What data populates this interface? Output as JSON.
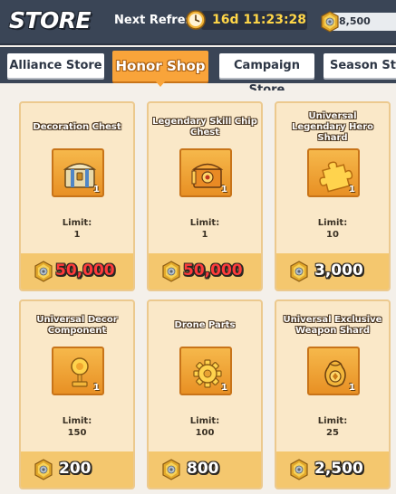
{
  "header": {
    "title": "STORE",
    "refresh_label": "Next Refresh:",
    "timer": "16d 11:23:28",
    "honor_balance": "8,500"
  },
  "tabs": [
    {
      "label": "Alliance Store",
      "active": false
    },
    {
      "label": "Honor Shop",
      "active": true
    },
    {
      "label": "Campaign Store",
      "active": false
    },
    {
      "label": "Season St",
      "active": false
    }
  ],
  "items": [
    {
      "name": "Decoration Chest",
      "qty": "1",
      "limit_label": "Limit:",
      "limit": "1",
      "price": "50,000",
      "price_color": "#ff3b3b",
      "icon": "chest-icon"
    },
    {
      "name": "Legendary Skill Chip Chest",
      "qty": "1",
      "limit_label": "Limit:",
      "limit": "1",
      "price": "50,000",
      "price_color": "#ff3b3b",
      "icon": "skill-chip-chest-icon"
    },
    {
      "name": "Universal Legendary Hero Shard",
      "qty": "1",
      "limit_label": "Limit:",
      "limit": "10",
      "price": "3,000",
      "price_color": "#ffffff",
      "icon": "puzzle-piece-icon"
    },
    {
      "name": "Universal Decor Component",
      "qty": "1",
      "limit_label": "Limit:",
      "limit": "150",
      "price": "200",
      "price_color": "#ffffff",
      "icon": "trophy-icon"
    },
    {
      "name": "Drone Parts",
      "qty": "1",
      "limit_label": "Limit:",
      "limit": "100",
      "price": "800",
      "price_color": "#ffffff",
      "icon": "gear-icon"
    },
    {
      "name": "Universal Exclusive Weapon Shard",
      "qty": "1",
      "limit_label": "Limit:",
      "limit": "25",
      "price": "2,500",
      "price_color": "#ffffff",
      "icon": "weapon-shard-icon"
    }
  ],
  "colors": {
    "accent": "#f9a43a",
    "header_bg": "#3a4556",
    "card_bg": "#fae8c8",
    "price_bar": "#f4c76e",
    "insufficient": "#ff3b3b",
    "timer": "#ffd648"
  }
}
